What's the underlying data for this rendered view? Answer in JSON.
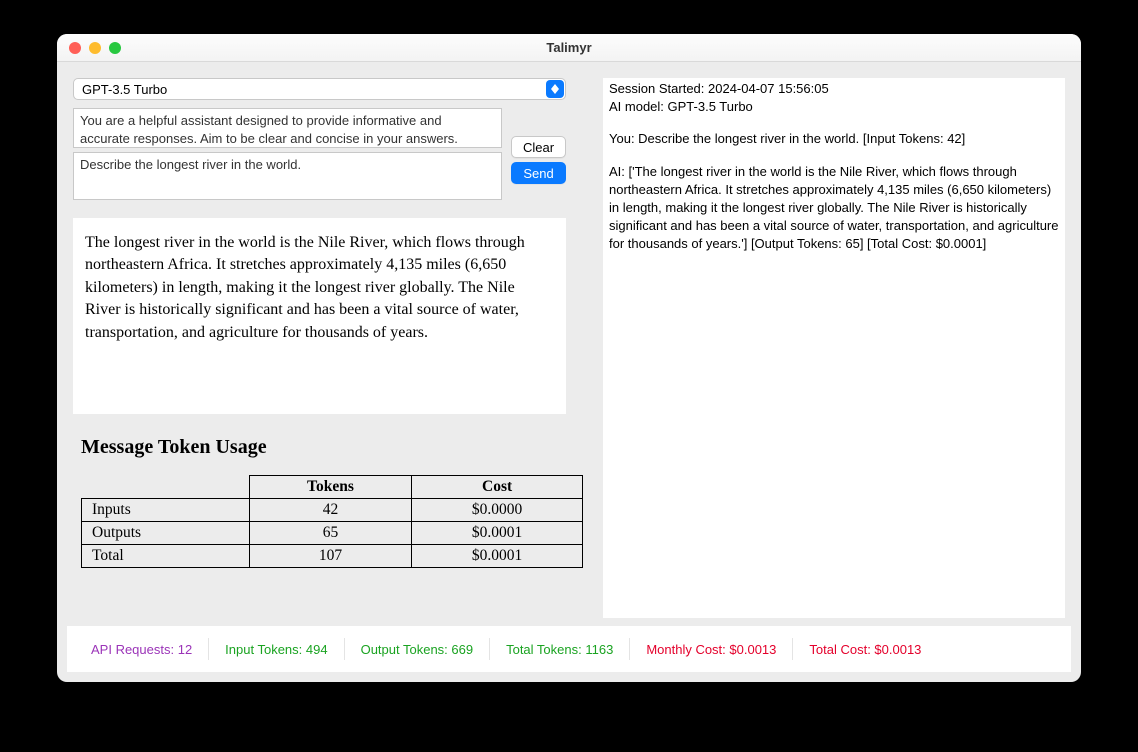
{
  "window": {
    "title": "Talimyr"
  },
  "model_select": {
    "value": "GPT-3.5 Turbo"
  },
  "system_prompt": "You are a helpful assistant designed to provide informative and accurate responses. Aim to be clear and concise in your answers.",
  "user_prompt": "Describe the longest river in the world.",
  "buttons": {
    "clear": "Clear",
    "send": "Send"
  },
  "response": "The longest river in the world is the Nile River, which flows through northeastern Africa. It stretches approximately 4,135 miles (6,650 kilometers) in length, making it the longest river globally. The Nile River is historically significant and has been a vital source of water, transportation, and agriculture for thousands of years.",
  "usage_heading": "Message Token Usage",
  "token_table": {
    "headers": {
      "tokens": "Tokens",
      "cost": "Cost"
    },
    "rows": [
      {
        "label": "Inputs",
        "tokens": "42",
        "cost": "$0.0000"
      },
      {
        "label": "Outputs",
        "tokens": "65",
        "cost": "$0.0001"
      },
      {
        "label": "Total",
        "tokens": "107",
        "cost": "$0.0001"
      }
    ]
  },
  "log": {
    "line1": "Session Started: 2024-04-07 15:56:05",
    "line2": "AI model: GPT-3.5 Turbo",
    "you": "You: Describe the longest river in the world. [Input Tokens: 42]",
    "ai": "AI: ['The longest river in the world is the Nile River, which flows through northeastern Africa. It stretches approximately 4,135 miles (6,650 kilometers) in length, making it the longest river globally. The Nile River is historically significant and has been a vital source of water, transportation, and agriculture for thousands of years.'] [Output Tokens: 65] [Total Cost: $0.0001]"
  },
  "footer": {
    "api_requests": "API Requests: 12",
    "input_tokens": "Input Tokens: 494",
    "output_tokens": "Output Tokens: 669",
    "total_tokens": "Total Tokens: 1163",
    "monthly_cost": "Monthly Cost: $0.0013",
    "total_cost": "Total Cost: $0.0013"
  }
}
